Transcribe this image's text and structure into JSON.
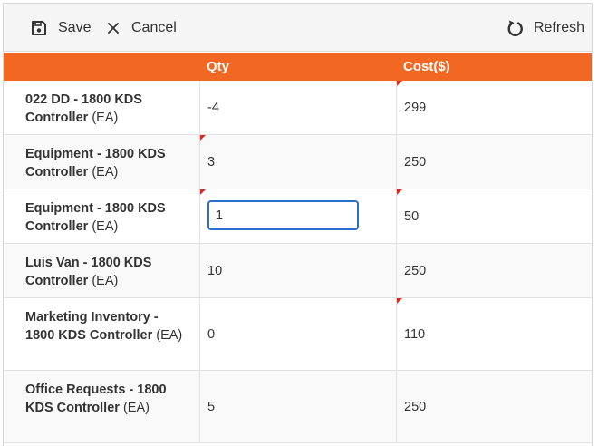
{
  "toolbar": {
    "save_label": "Save",
    "cancel_label": "Cancel",
    "refresh_label": "Refresh"
  },
  "table": {
    "columns": [
      "",
      "Qty",
      "Cost($)"
    ],
    "rows": [
      {
        "name": "022 DD - 1800 KDS Controller",
        "unit": "(EA)",
        "qty": "-4",
        "cost": "299",
        "qty_changed": false,
        "cost_changed": true
      },
      {
        "name": "Equipment - 1800 KDS Controller",
        "unit": "(EA)",
        "qty": "3",
        "cost": "250",
        "qty_changed": true,
        "cost_changed": false
      },
      {
        "name": "Equipment - 1800 KDS Controller",
        "unit": "(EA)",
        "qty": "1",
        "cost": "50",
        "qty_changed": true,
        "cost_changed": true,
        "editing": true
      },
      {
        "name": "Luis Van - 1800 KDS Controller",
        "unit": "(EA)",
        "qty": "10",
        "cost": "250",
        "qty_changed": false,
        "cost_changed": false
      },
      {
        "name": "Marketing Inventory - 1800 KDS Controller",
        "unit": "(EA)",
        "qty": "0",
        "cost": "110",
        "qty_changed": false,
        "cost_changed": true
      },
      {
        "name": "Office Requests - 1800 KDS Controller",
        "unit": "(EA)",
        "qty": "5",
        "cost": "250",
        "qty_changed": false,
        "cost_changed": false
      }
    ]
  },
  "colors": {
    "header_bg": "#f26722",
    "dirty_flag": "#e8231a",
    "focus_border": "#2a6ed1"
  }
}
